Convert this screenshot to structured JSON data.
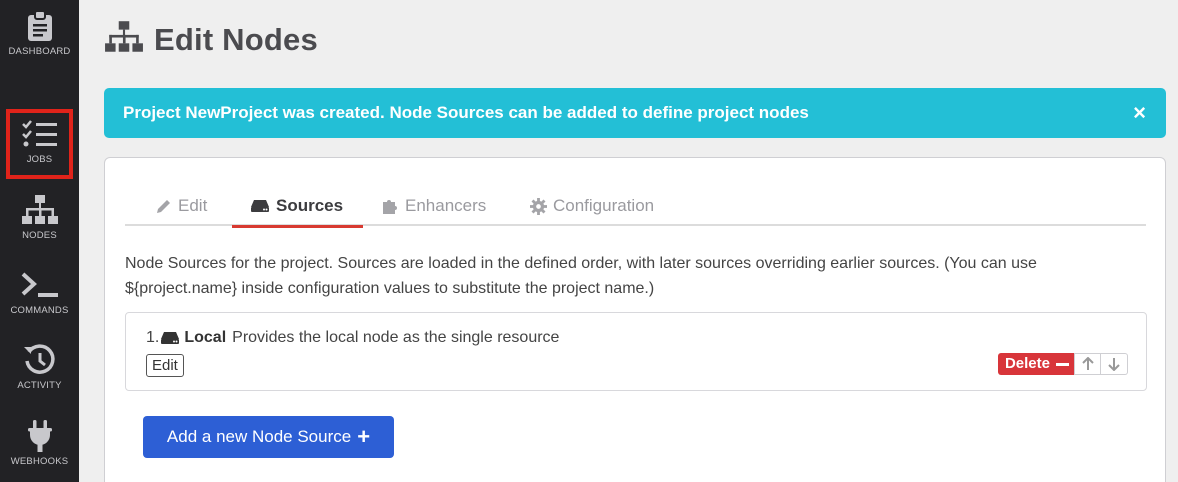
{
  "sidebar": {
    "items": [
      {
        "label": "DASHBOARD",
        "icon": "clipboard-icon"
      },
      {
        "label": "JOBS",
        "icon": "checklist-icon",
        "selected": true
      },
      {
        "label": "NODES",
        "icon": "sitemap-icon"
      },
      {
        "label": "COMMANDS",
        "icon": "terminal-icon"
      },
      {
        "label": "ACTIVITY",
        "icon": "history-icon"
      },
      {
        "label": "WEBHOOKS",
        "icon": "plug-icon"
      }
    ]
  },
  "page": {
    "title": "Edit Nodes",
    "title_icon": "sitemap-icon"
  },
  "alert": {
    "message": "Project NewProject was created. Node Sources can be added to define project nodes",
    "close_label": "×",
    "color": "#23bfd6"
  },
  "tabs": [
    {
      "label": "Edit",
      "icon": "pencil-icon"
    },
    {
      "label": "Sources",
      "icon": "hdd-icon",
      "active": true
    },
    {
      "label": "Enhancers",
      "icon": "puzzle-icon"
    },
    {
      "label": "Configuration",
      "icon": "gear-icon"
    }
  ],
  "sources": {
    "description": "Node Sources for the project. Sources are loaded in the defined order, with later sources overriding earlier sources. (You can use ${project.name} inside configuration values to substitute the project name.)",
    "items": [
      {
        "number": "1.",
        "name": "Local",
        "description": "Provides the local node as the single resource",
        "edit_label": "Edit",
        "delete_label": "Delete"
      }
    ],
    "add_label": "Add a new Node Source",
    "add_icon": "plus-icon"
  },
  "colors": {
    "sidebar_bg": "#222225",
    "accent_red": "#d83a31",
    "primary_blue": "#2d5fd5",
    "info_cyan": "#23bfd6"
  }
}
